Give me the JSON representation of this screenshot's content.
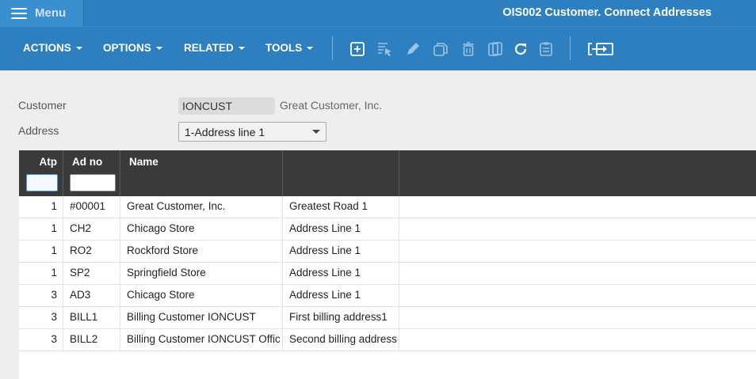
{
  "header": {
    "menu_label": "Menu",
    "title": "OIS002 Customer. Connect Addresses"
  },
  "toolbar": {
    "menus": [
      "ACTIONS",
      "OPTIONS",
      "RELATED",
      "TOOLS"
    ],
    "icons": [
      "add-icon",
      "select-icon",
      "edit-icon",
      "copy-icon",
      "delete-icon",
      "duplicate-icon",
      "refresh-icon",
      "clipboard-icon",
      "export-icon"
    ]
  },
  "form": {
    "customer_label": "Customer",
    "customer_value": "IONCUST",
    "customer_name": "Great Customer, Inc.",
    "address_label": "Address",
    "address_value": "1-Address line 1"
  },
  "table": {
    "columns": [
      "Atp",
      "Ad no",
      "Name",
      ""
    ],
    "rows": [
      [
        "1",
        "#00001",
        "Great Customer, Inc.",
        "Greatest Road 1"
      ],
      [
        "1",
        "CH2",
        "Chicago Store",
        "Address Line 1"
      ],
      [
        "1",
        "RO2",
        "Rockford Store",
        "Address Line 1"
      ],
      [
        "1",
        "SP2",
        "Springfield Store",
        "Address Line 1"
      ],
      [
        "3",
        "AD3",
        "Chicago Store",
        "Address Line 1"
      ],
      [
        "3",
        "BILL1",
        "Billing Customer IONCUST",
        "First billing address1"
      ],
      [
        "3",
        "BILL2",
        "Billing Customer IONCUST Offic",
        "Second billing address"
      ]
    ]
  }
}
